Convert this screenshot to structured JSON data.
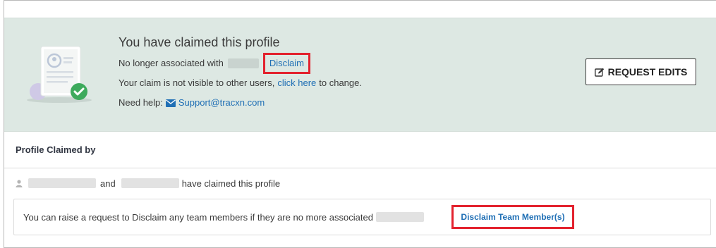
{
  "banner": {
    "title": "You have claimed this profile",
    "no_longer_prefix": "No longer associated with",
    "disclaim_link": "Disclaim",
    "visibility_prefix": "Your claim is not visible to other users,",
    "click_here_link": "click here",
    "visibility_suffix": "to change.",
    "help_prefix": "Need help:",
    "support_email": "Support@tracxn.com",
    "request_edits_label": "REQUEST EDITS",
    "colors": {
      "banner_bg": "#dde8e3",
      "link": "#1f6fb5",
      "highlight": "#e3222e",
      "check": "#3daa5c"
    }
  },
  "claimed": {
    "header": "Profile Claimed by",
    "and_text": "and",
    "have_claimed_text": "have claimed this profile",
    "info_text": "You can raise a request to Disclaim any team members if they are no more associated",
    "disclaim_team_link": "Disclaim Team Member(s)"
  }
}
